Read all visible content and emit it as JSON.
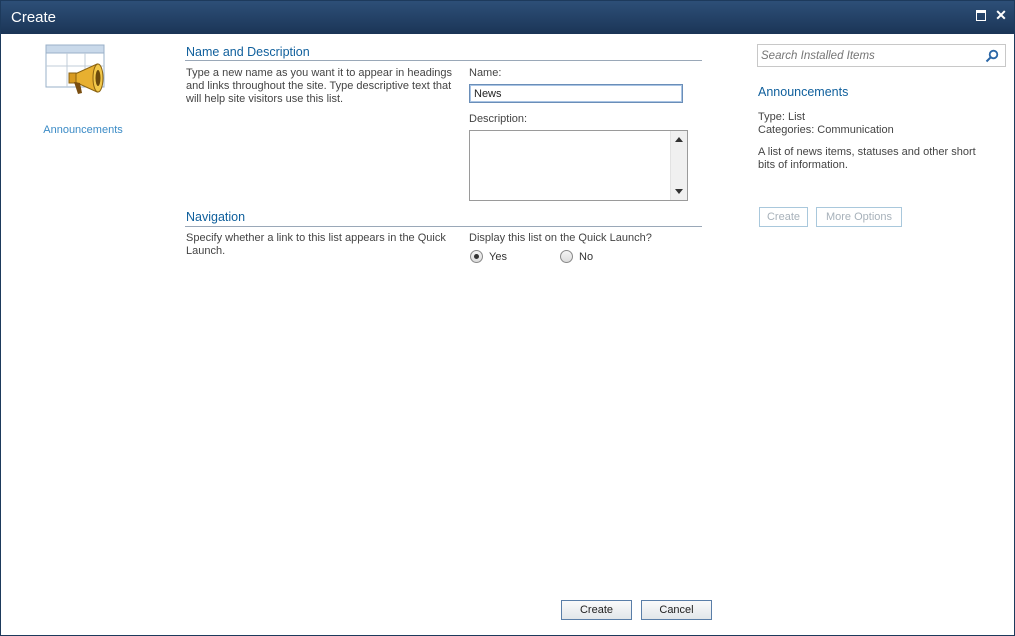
{
  "window": {
    "title": "Create",
    "maximize_icon": "maximize-icon",
    "close_icon": "close-icon"
  },
  "left": {
    "icon": "announcements-list-icon",
    "label": "Announcements"
  },
  "name_section": {
    "title": "Name and Description",
    "help": "Type a new name as you want it to appear in headings and links throughout the site. Type descriptive text that will help site visitors use this list.",
    "name_label": "Name:",
    "name_value": "News",
    "description_label": "Description:",
    "description_value": ""
  },
  "navigation_section": {
    "title": "Navigation",
    "help": "Specify whether a link to this list appears in the Quick Launch.",
    "question": "Display this list on the Quick Launch?",
    "options": [
      {
        "label": "Yes",
        "selected": true
      },
      {
        "label": "No",
        "selected": false
      }
    ]
  },
  "search": {
    "placeholder": "Search Installed Items",
    "icon": "search-icon"
  },
  "details": {
    "title": "Announcements",
    "type": "Type: List",
    "categories": "Categories: Communication",
    "description": "A list of news items, statuses and other short bits of information.",
    "create_label": "Create",
    "more_options_label": "More Options"
  },
  "footer": {
    "create_label": "Create",
    "cancel_label": "Cancel"
  },
  "colors": {
    "titlebar": "#1b3556",
    "accent": "#0f5f9c",
    "link": "#3b8bc6"
  }
}
